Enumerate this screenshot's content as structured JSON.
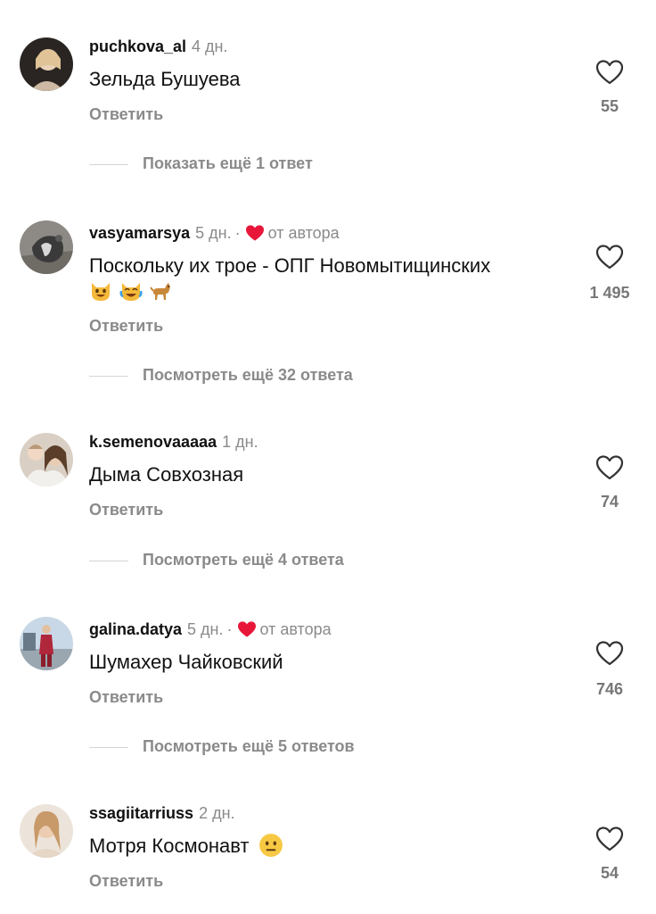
{
  "comments": [
    {
      "username": "puchkova_al",
      "time": "4 дн.",
      "text": "Зельда Бушуева",
      "likes": "55",
      "reply_label": "Ответить",
      "more_replies": "Показать ещё 1 ответ"
    },
    {
      "username": "vasyamarsya",
      "time": "5 дн.",
      "dot": "·",
      "author_like_label": "от автора",
      "text": "Поскольку их трое - ОПГ Новомытищинских",
      "emojis": [
        "cat-smile-emoji",
        "laughing-crying-emoji",
        "dog-emoji"
      ],
      "likes": "1 495",
      "reply_label": "Ответить",
      "more_replies": "Посмотреть ещё 32 ответа"
    },
    {
      "username": "k.semenovaaaaa",
      "time": "1 дн.",
      "text": "Дыма Совхозная",
      "likes": "74",
      "reply_label": "Ответить",
      "more_replies": "Посмотреть ещё 4 ответа"
    },
    {
      "username": "galina.datya",
      "time": "5 дн.",
      "dot": "·",
      "author_like_label": "от автора",
      "text": "Шумахер Чайковский",
      "likes": "746",
      "reply_label": "Ответить",
      "more_replies": "Посмотреть ещё 5 ответов"
    },
    {
      "username": "ssagiitarriuss",
      "time": "2 дн.",
      "text": "Мотря Космонавт",
      "emojis": [
        "neutral-face-emoji"
      ],
      "likes": "54",
      "reply_label": "Ответить"
    }
  ],
  "colors": {
    "author_heart": "#e8173a",
    "secondary_text": "#8a8a8a",
    "primary_text": "#111111"
  }
}
